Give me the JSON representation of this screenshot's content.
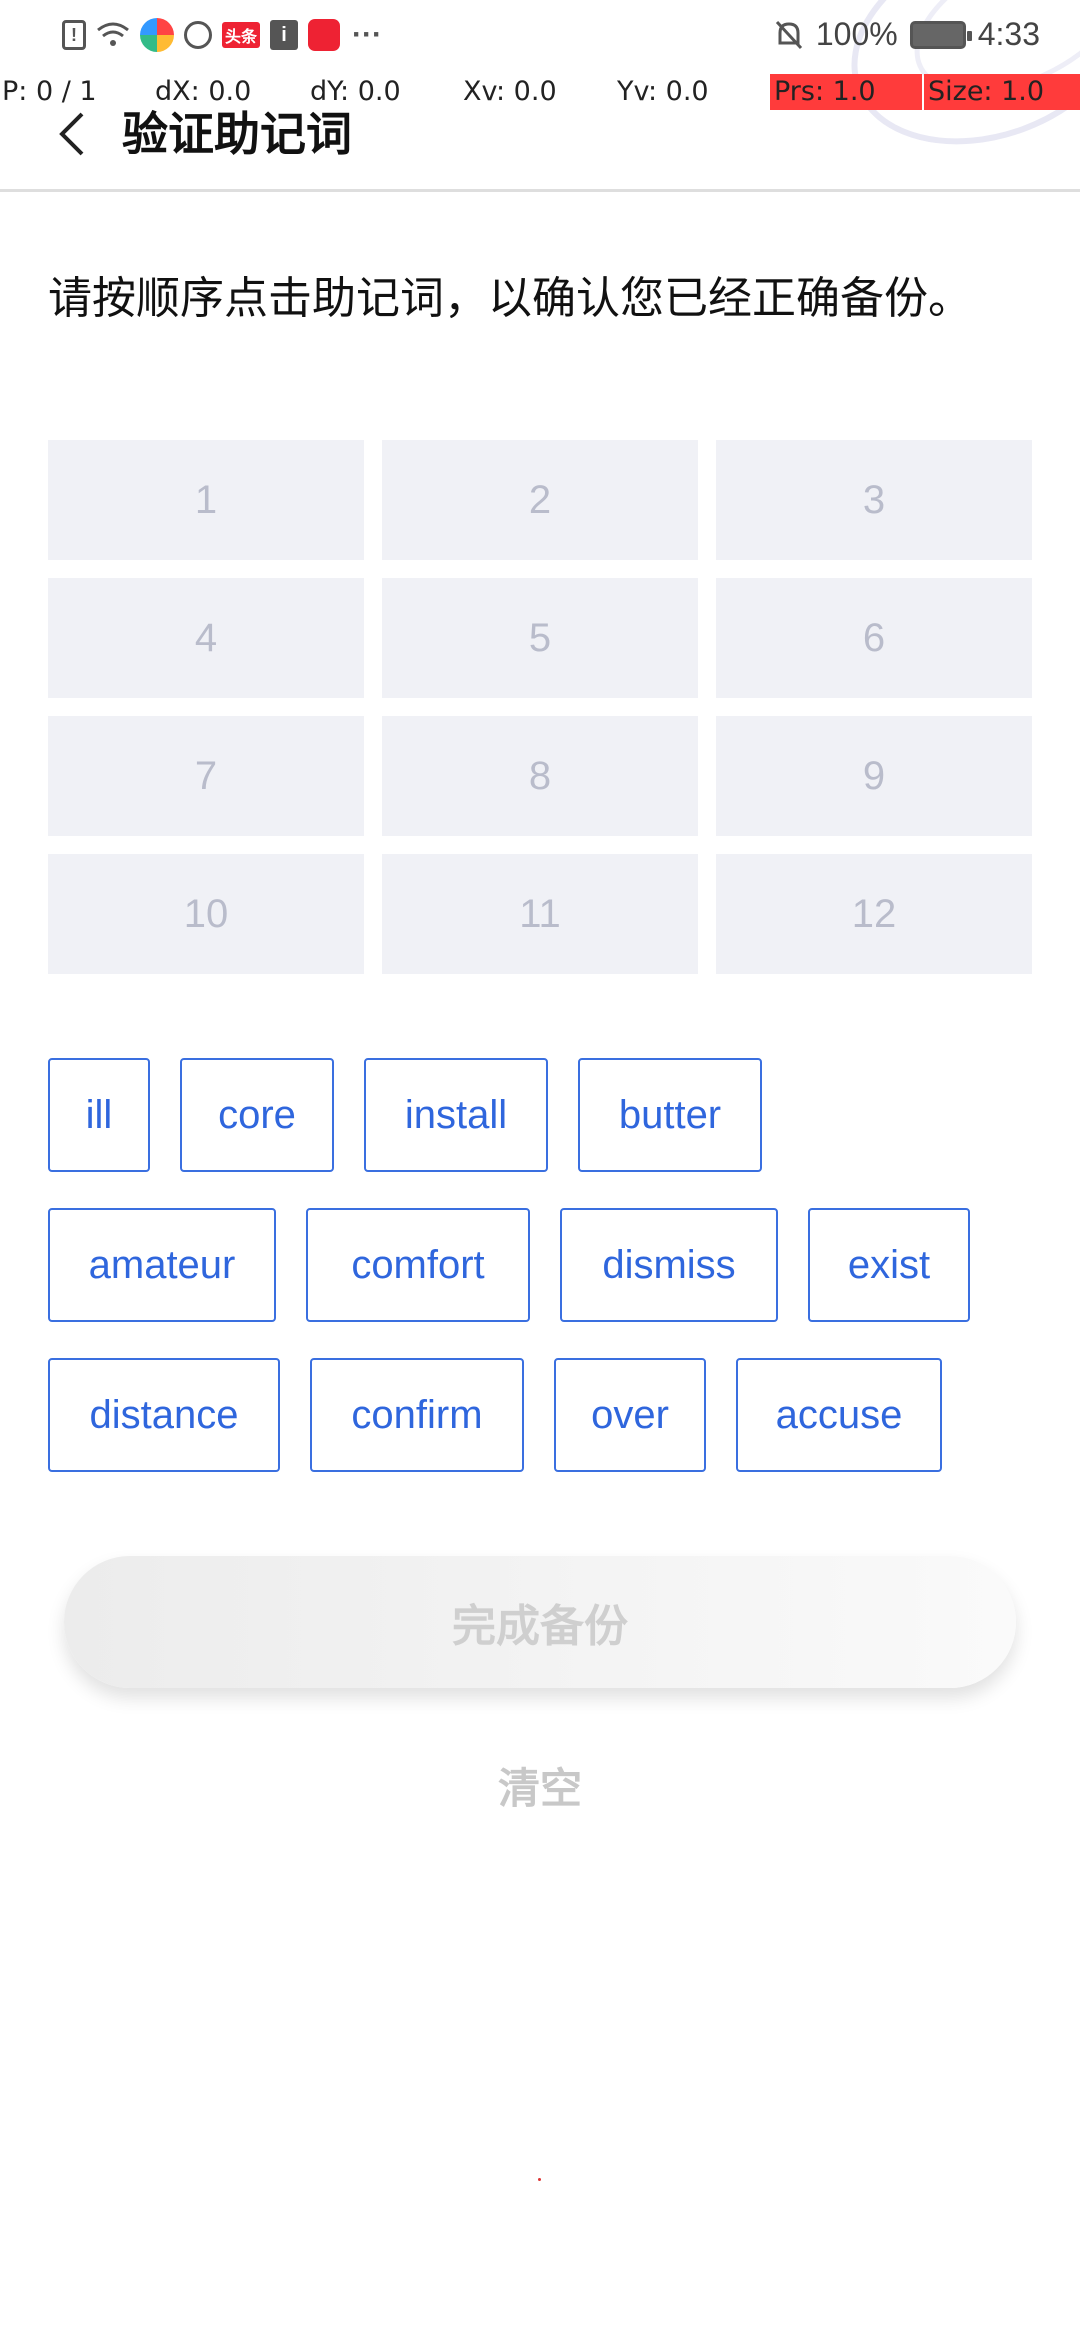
{
  "status_bar": {
    "battery": "100%",
    "time": "4:33",
    "app_badge_toutiao": "头条"
  },
  "debug_overlay": {
    "pointer": "P: 0 / 1",
    "dx": "dX: 0.0",
    "dy": "dY: 0.0",
    "xv": "Xv: 0.0",
    "yv": "Yv: 0.0",
    "prs": "Prs: 1.0",
    "size": "Size: 1.0"
  },
  "header": {
    "title": "验证助记词"
  },
  "instruction": "请按顺序点击助记词，以确认您已经正确备份。",
  "slots": [
    "1",
    "2",
    "3",
    "4",
    "5",
    "6",
    "7",
    "8",
    "9",
    "10",
    "11",
    "12"
  ],
  "words": [
    "ill",
    "core",
    "install",
    "butter",
    "amateur",
    "comfort",
    "dismiss",
    "exist",
    "distance",
    "confirm",
    "over",
    "accuse"
  ],
  "actions": {
    "done_label": "完成备份",
    "clear_label": "清空"
  },
  "colors": {
    "word_border": "#3a6fe0",
    "slot_bg": "#f0f1f6",
    "debug_highlight": "#ff3b3b"
  }
}
